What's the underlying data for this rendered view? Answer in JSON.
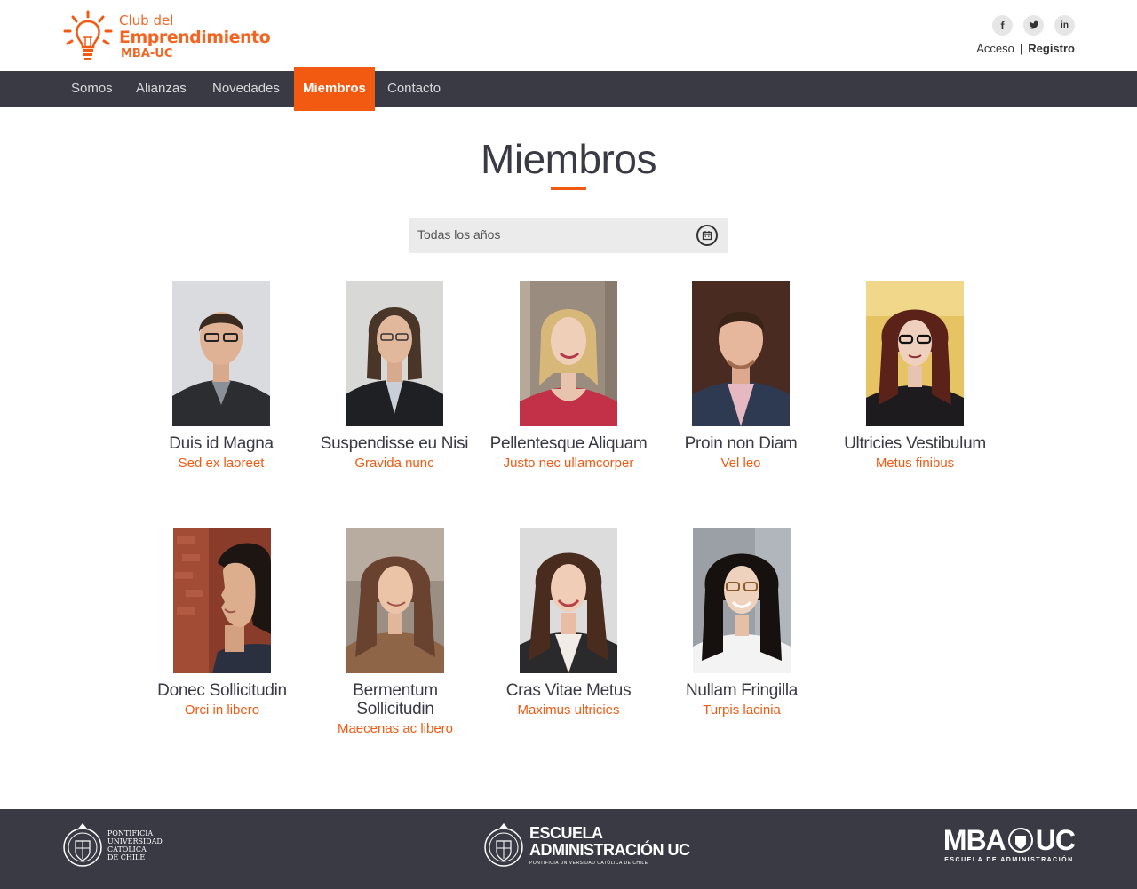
{
  "brand": {
    "line1": "Club del",
    "line2": "Emprendimiento",
    "line3": "MBA-UC",
    "accent": "#f25a12"
  },
  "social": [
    {
      "icon": "facebook-icon",
      "glyph": "f"
    },
    {
      "icon": "twitter-icon",
      "glyph": "🐦"
    },
    {
      "icon": "linkedin-icon",
      "glyph": "in"
    }
  ],
  "auth": {
    "login": "Acceso",
    "separator": "|",
    "register": "Registro"
  },
  "nav": {
    "items": [
      {
        "label": "Somos"
      },
      {
        "label": "Alianzas"
      },
      {
        "label": "Novedades"
      },
      {
        "label": "Miembros",
        "active": true
      },
      {
        "label": "Contacto"
      }
    ]
  },
  "page": {
    "title": "Miembros",
    "filter_value": "Todas los años"
  },
  "members": [
    {
      "name": "Duis id Magna",
      "role": "Sed ex laoreet"
    },
    {
      "name": "Suspendisse eu Nisi",
      "role": "Gravida nunc"
    },
    {
      "name": "Pellentesque Aliquam",
      "role": "Justo nec ullamcorper"
    },
    {
      "name": "Proin non Diam",
      "role": "Vel leo"
    },
    {
      "name": "Ultricies Vestibulum",
      "role": "Metus finibus"
    },
    {
      "name": "Donec Sollicitudin",
      "role": "Orci in libero"
    },
    {
      "name": "Bermentum Sollicitudin",
      "role": "Maecenas ac libero"
    },
    {
      "name": "Cras Vitae Metus",
      "role": "Maximus ultricies"
    },
    {
      "name": "Nullam Fringilla",
      "role": "Turpis lacinia"
    }
  ],
  "footer": {
    "puc_line1": "PONTIFICIA",
    "puc_line2": "UNIVERSIDAD",
    "puc_line3": "CATÓLICA",
    "puc_line4": "DE CHILE",
    "escuela_line1": "ESCUELA",
    "escuela_line2": "ADMINISTRACIÓN UC",
    "escuela_line3": "PONTIFICIA UNIVERSIDAD CATÓLICA DE CHILE",
    "mba_left": "MBA",
    "mba_right": "UC",
    "mba_sub": "ESCUELA DE ADMINISTRACIÓN"
  }
}
